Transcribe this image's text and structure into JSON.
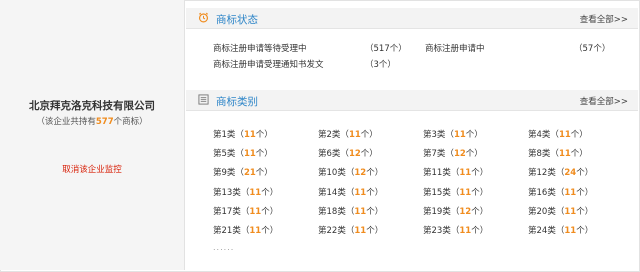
{
  "company": {
    "name": "北京拜克洛克科技有限公司",
    "count_prefix": "（该企业共持有",
    "count_value": "577",
    "count_suffix": "个商标）",
    "cancel_label": "取消该企业监控"
  },
  "status": {
    "title": "商标状态",
    "more_label": "查看全部>>",
    "items": [
      {
        "label": "商标注册申请等待受理中",
        "value": "（517个）"
      },
      {
        "label": "商标注册申请中",
        "value": "（57个）"
      },
      {
        "label": "商标注册申请受理通知书发文",
        "value": "（3个）"
      }
    ]
  },
  "categories": {
    "title": "商标类别",
    "more_label": "查看全部>>",
    "ellipsis": "......",
    "items": [
      {
        "name": "第1类",
        "count": "11个"
      },
      {
        "name": "第2类",
        "count": "11个"
      },
      {
        "name": "第3类",
        "count": "11个"
      },
      {
        "name": "第4类",
        "count": "11个"
      },
      {
        "name": "第5类",
        "count": "11个"
      },
      {
        "name": "第6类",
        "count": "12个"
      },
      {
        "name": "第7类",
        "count": "12个"
      },
      {
        "name": "第8类",
        "count": "11个"
      },
      {
        "name": "第9类",
        "count": "21个"
      },
      {
        "name": "第10类",
        "count": "12个"
      },
      {
        "name": "第11类",
        "count": "11个"
      },
      {
        "name": "第12类",
        "count": "24个"
      },
      {
        "name": "第13类",
        "count": "11个"
      },
      {
        "name": "第14类",
        "count": "11个"
      },
      {
        "name": "第15类",
        "count": "11个"
      },
      {
        "name": "第16类",
        "count": "11个"
      },
      {
        "name": "第17类",
        "count": "11个"
      },
      {
        "name": "第18类",
        "count": "11个"
      },
      {
        "name": "第19类",
        "count": "12个"
      },
      {
        "name": "第20类",
        "count": "11个"
      },
      {
        "name": "第21类",
        "count": "11个"
      },
      {
        "name": "第22类",
        "count": "11个"
      },
      {
        "name": "第23类",
        "count": "11个"
      },
      {
        "name": "第24类",
        "count": "11个"
      }
    ]
  },
  "colors": {
    "accent": "#2f86c8",
    "highlight": "#f08c1e",
    "alert": "#d81e06"
  },
  "icons": {
    "status": "alarm-clock-icon",
    "categories": "list-icon"
  }
}
